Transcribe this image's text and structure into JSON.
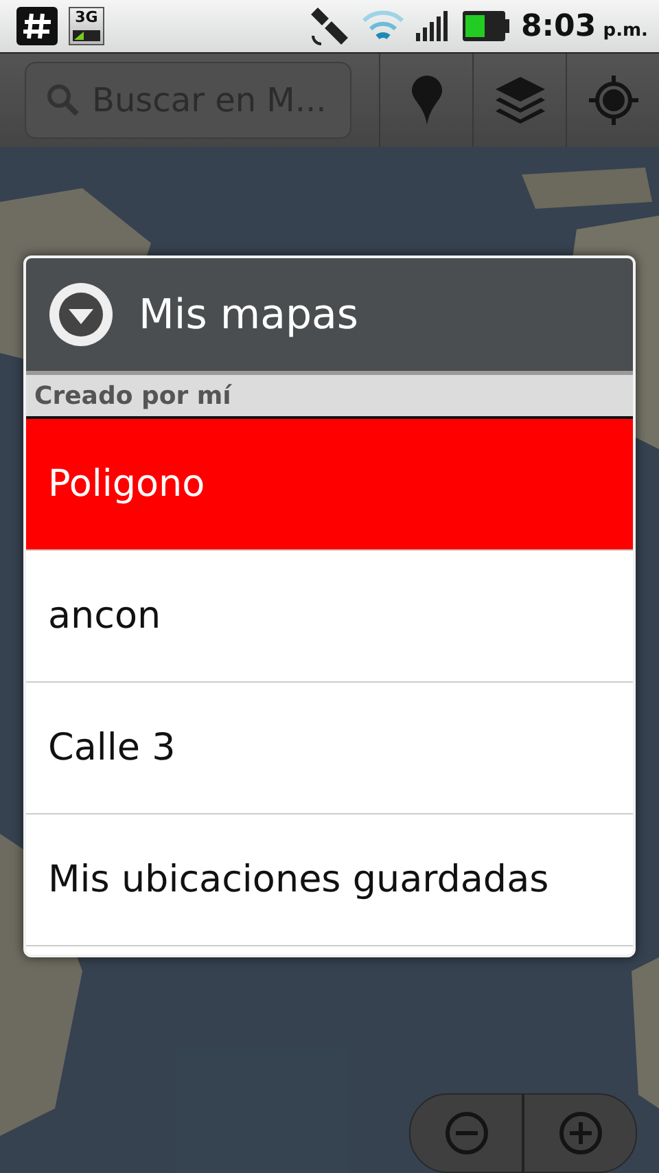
{
  "status_bar": {
    "network_type": "3G",
    "time": "8:03",
    "meridiem": "p.m."
  },
  "toolbar": {
    "search": {
      "placeholder": "Buscar en M..."
    }
  },
  "dialog": {
    "title": "Mis mapas",
    "section": "Creado por mí",
    "items": [
      {
        "label": "Poligono",
        "selected": true
      },
      {
        "label": "ancon",
        "selected": false
      },
      {
        "label": "Calle 3",
        "selected": false
      },
      {
        "label": "Mis ubicaciones guardadas",
        "selected": false
      }
    ]
  }
}
